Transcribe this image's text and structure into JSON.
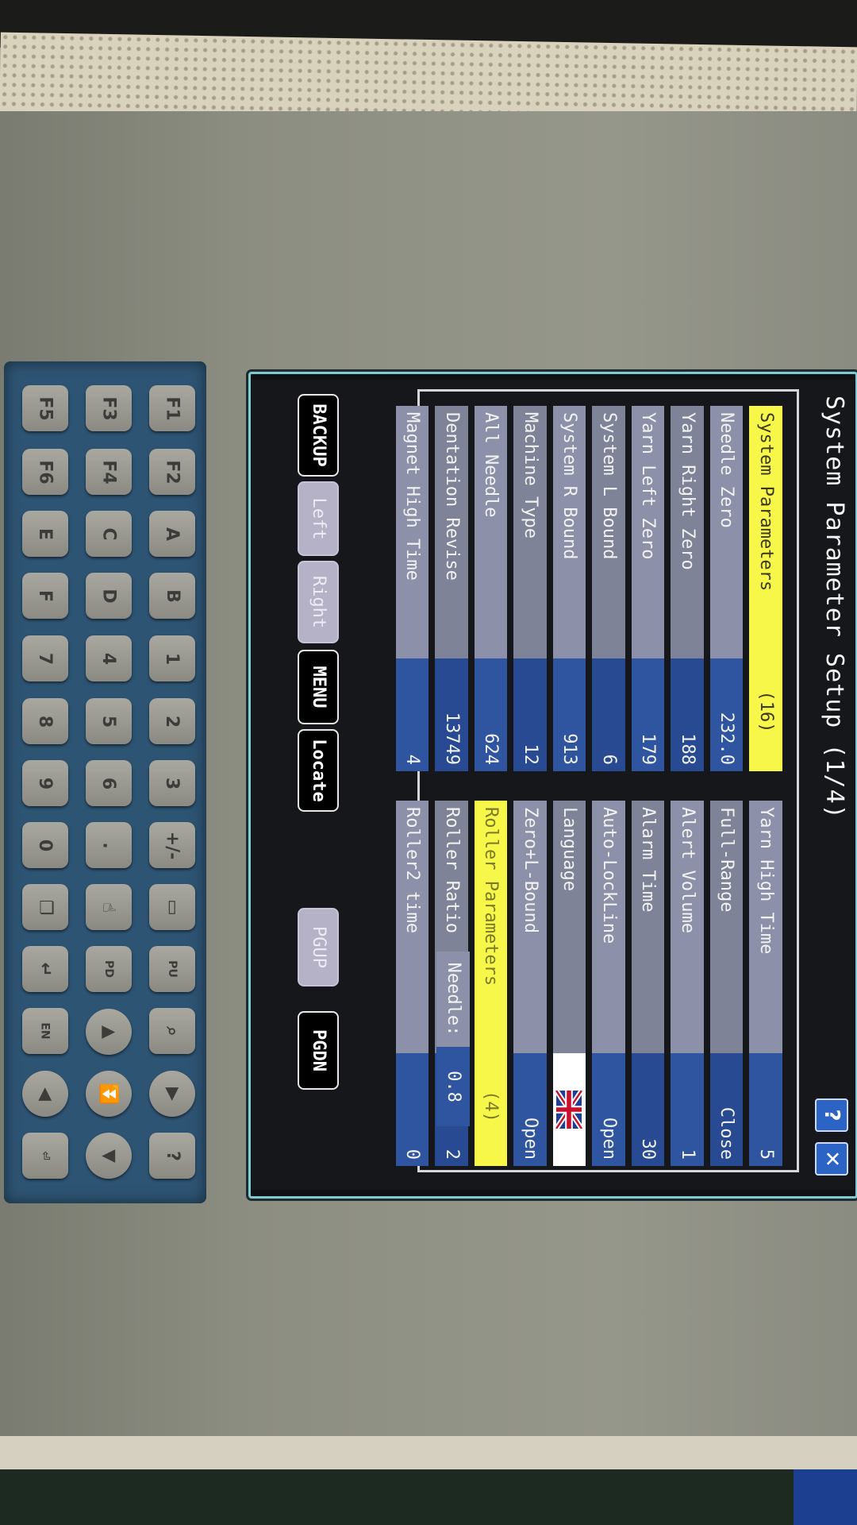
{
  "screen": {
    "title": "System Parameter Setup (1/4)",
    "help_label": "?",
    "close_label": "✕",
    "left_table": [
      {
        "label": "System Parameters",
        "value": "(16)",
        "kind": "header"
      },
      {
        "label": "Needle Zero",
        "value": "232.0"
      },
      {
        "label": "Yarn Right Zero",
        "value": "188"
      },
      {
        "label": "Yarn Left Zero",
        "value": "179"
      },
      {
        "label": "System L Bound",
        "value": "6"
      },
      {
        "label": "System R Bound",
        "value": "913"
      },
      {
        "label": "Machine Type",
        "value": "12"
      },
      {
        "label": "All Needle",
        "value": "624"
      },
      {
        "label": "Dentation Revise",
        "value": "13749"
      },
      {
        "label": "Magnet High Time",
        "value": "4"
      }
    ],
    "right_table": [
      {
        "label": "Yarn High Time",
        "value": "5"
      },
      {
        "label": "Full-Range",
        "value": "Close"
      },
      {
        "label": "Alert Volume",
        "value": "1"
      },
      {
        "label": "Alarm Time",
        "value": "30"
      },
      {
        "label": "Auto-LockLine",
        "value": "Open"
      },
      {
        "label": "Language",
        "value": "",
        "icon": "uk-flag-icon"
      },
      {
        "label": "Zero+L-Bound",
        "value": "Open"
      },
      {
        "label": "Roller Parameters",
        "value": "(4)",
        "kind": "header"
      },
      {
        "label": "Roller Ratio",
        "value": "2"
      },
      {
        "label": "Roller2 time",
        "value": "0"
      }
    ],
    "needle_label": "Needle:",
    "needle_value": "0.8",
    "buttons": {
      "backup": "BACKUP",
      "left": "Left",
      "right": "Right",
      "menu": "MENU",
      "locate": "Locate",
      "pgup": "PGUP",
      "pgdn": "PGDN"
    }
  },
  "keypad": {
    "row1": [
      "F1",
      "F2",
      "A",
      "B",
      "1",
      "2",
      "3",
      "+/-"
    ],
    "row2": [
      "F3",
      "F4",
      "C",
      "D",
      "4",
      "5",
      "6",
      "."
    ],
    "row3": [
      "F5",
      "F6",
      "E",
      "F",
      "7",
      "8",
      "9",
      "0"
    ],
    "extra_keys": [
      "?"
    ]
  },
  "colors": {
    "header_yellow": "#f7f74a",
    "label_bg": "#8c90a8",
    "value_bg": "#2f55a0",
    "screen_border": "#7fc9d2"
  }
}
